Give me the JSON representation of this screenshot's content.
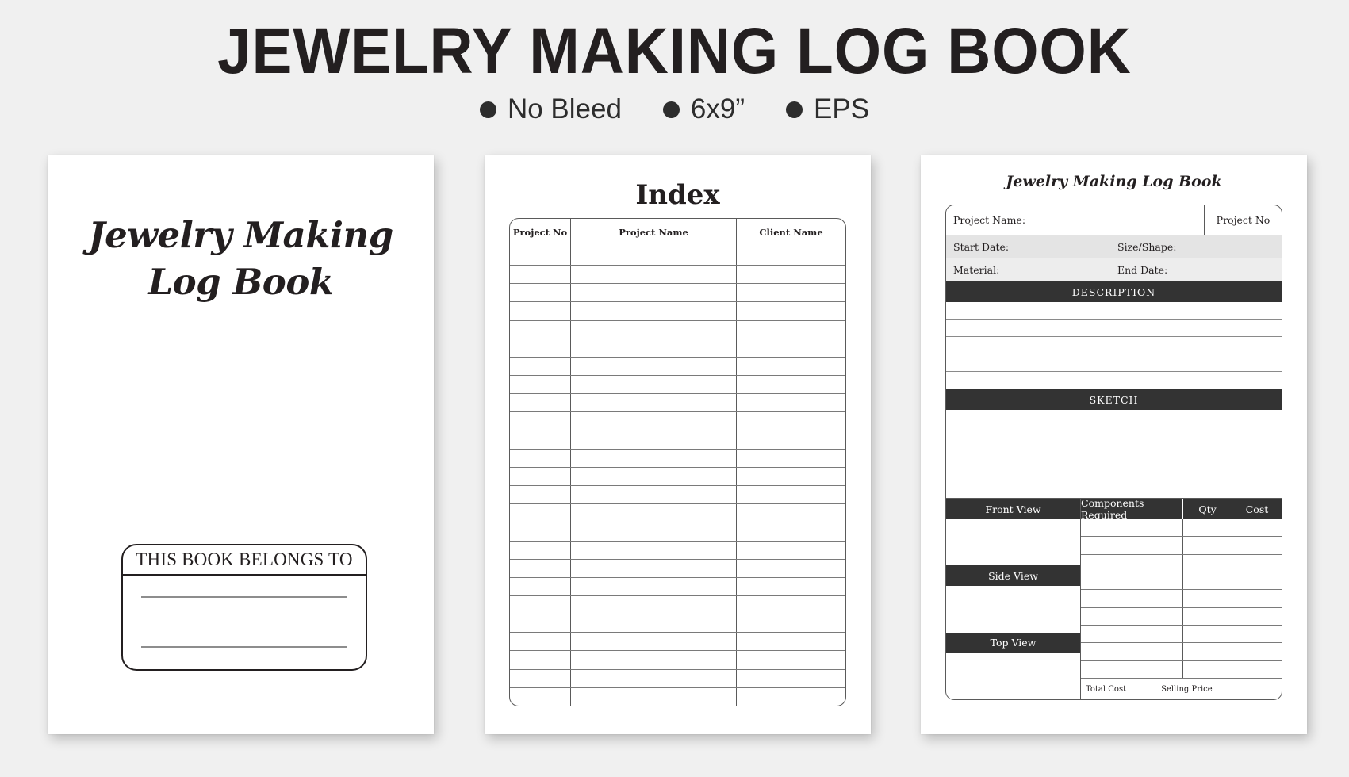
{
  "header": {
    "title": "JEWELRY MAKING LOG BOOK",
    "badges": [
      {
        "icon": "bullet-dot-icon",
        "label": "No Bleed"
      },
      {
        "icon": "bullet-dot-icon",
        "label": "6x9”"
      },
      {
        "icon": "bullet-dot-icon",
        "label": "EPS"
      }
    ]
  },
  "cover": {
    "title_line1": "Jewelry Making",
    "title_line2": "Log Book",
    "belongs_to_label": "THIS BOOK BELONGS TO",
    "belongs_to_lines": 3
  },
  "index": {
    "title": "Index",
    "columns": [
      {
        "label": "Project No"
      },
      {
        "label": "Project Name"
      },
      {
        "label": "Client Name"
      }
    ],
    "row_count": 25,
    "rows": []
  },
  "log": {
    "title": "Jewelry Making Log Book",
    "fields": {
      "project_name": "Project Name:",
      "project_no": "Project No",
      "start_date": "Start Date:",
      "size_shape": "Size/Shape:",
      "material": "Material:",
      "end_date": "End Date:"
    },
    "sections": {
      "description": "DESCRIPTION",
      "sketch": "SKETCH"
    },
    "description_line_count": 5,
    "views": [
      {
        "label": "Front View"
      },
      {
        "label": "Side View"
      },
      {
        "label": "Top View"
      }
    ],
    "components_columns": [
      {
        "label": "Components Required"
      },
      {
        "label": "Qty"
      },
      {
        "label": "Cost"
      }
    ],
    "components_row_count": 9,
    "totals": {
      "total_cost": "Total Cost",
      "selling_price": "Selling Price"
    }
  },
  "colors": {
    "background": "#f0f0f0",
    "ink": "#231f20",
    "bar_dark": "#333333",
    "rule": "#5a5a5a",
    "field_gray": "#e4e4e4"
  }
}
